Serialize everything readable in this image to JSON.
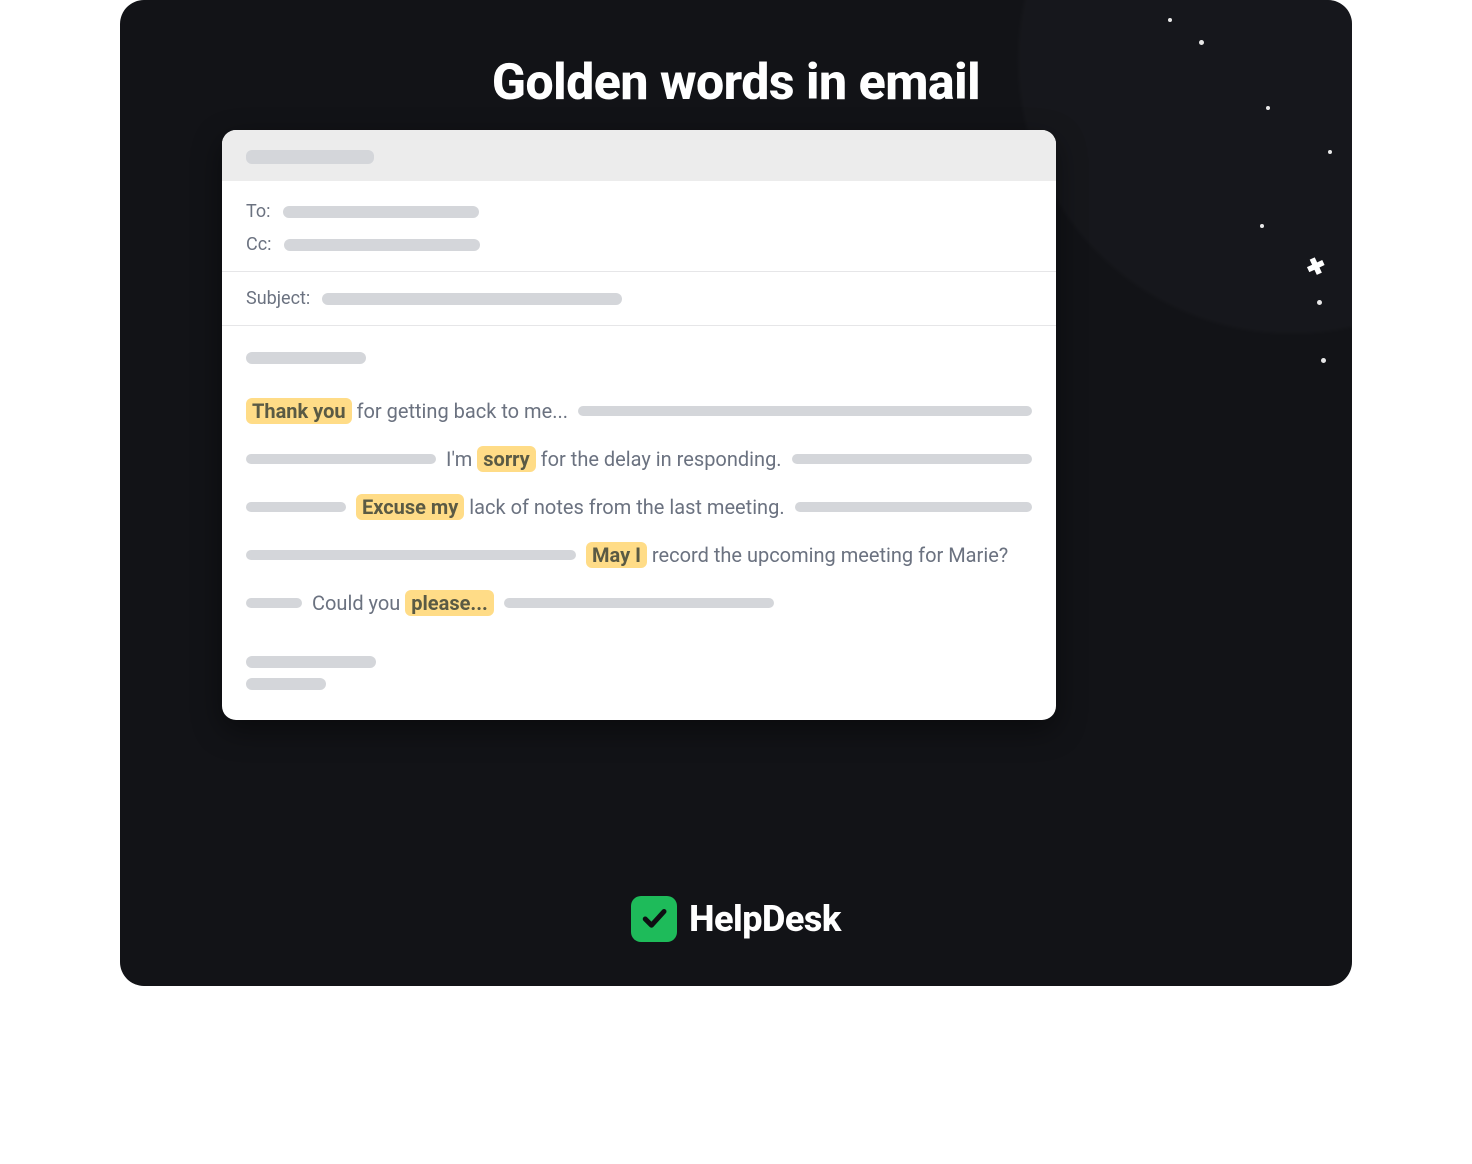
{
  "title": "Golden words in email",
  "email": {
    "labels": {
      "to": "To:",
      "cc": "Cc:",
      "subject": "Subject:"
    },
    "lines": {
      "l1_hl": "Thank you",
      "l1_after": " for getting back to me...",
      "l2_before": "I'm ",
      "l2_hl": "sorry",
      "l2_after": " for the delay in responding.",
      "l3_hl": "Excuse my",
      "l3_after": " lack of notes from the last meeting.",
      "l4_hl": "May I",
      "l4_after": " record the upcoming meeting for Marie?",
      "l5_before": "Could you ",
      "l5_hl": "please..."
    }
  },
  "brand": {
    "name": "HelpDesk"
  }
}
